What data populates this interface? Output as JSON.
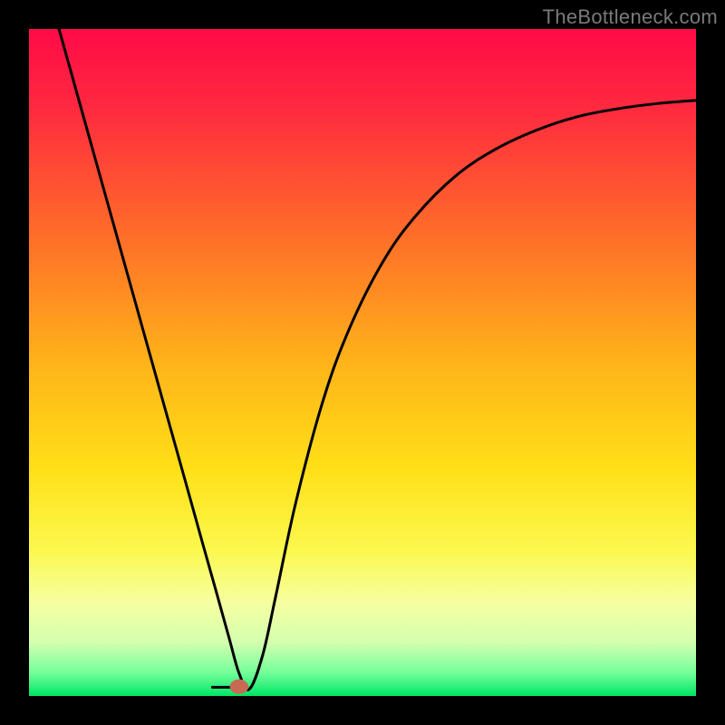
{
  "watermark": "TheBottleneck.com",
  "chart_data": {
    "type": "line",
    "title": "",
    "xlabel": "",
    "ylabel": "",
    "xlim": [
      0,
      100
    ],
    "ylim": [
      0,
      100
    ],
    "gradient_stops": [
      {
        "offset": 0.0,
        "color": "#ff0b47"
      },
      {
        "offset": 0.12,
        "color": "#ff2a3f"
      },
      {
        "offset": 0.3,
        "color": "#ff6a2a"
      },
      {
        "offset": 0.5,
        "color": "#ffb319"
      },
      {
        "offset": 0.66,
        "color": "#ffe018"
      },
      {
        "offset": 0.78,
        "color": "#fbf84d"
      },
      {
        "offset": 0.86,
        "color": "#f6ffa0"
      },
      {
        "offset": 0.92,
        "color": "#d4ffb0"
      },
      {
        "offset": 0.965,
        "color": "#74ff9a"
      },
      {
        "offset": 1.0,
        "color": "#00e564"
      }
    ],
    "series": [
      {
        "name": "bottleneck-curve",
        "x": [
          4.5,
          10,
          15,
          20,
          24,
          26,
          28,
          30,
          31.5,
          33,
          35,
          37,
          40,
          44,
          48,
          53,
          58,
          64,
          70,
          76,
          82,
          88,
          94,
          100
        ],
        "y": [
          100,
          80.3,
          62.4,
          44.5,
          30.2,
          23.0,
          15.9,
          8.7,
          3.4,
          1.0,
          6.0,
          15.0,
          29.0,
          44.0,
          55.0,
          65.0,
          72.0,
          78.0,
          82.0,
          84.8,
          86.8,
          88.0,
          88.8,
          89.3
        ]
      }
    ],
    "marker": {
      "x": 31.5,
      "y": 1.4,
      "rx": 1.4,
      "ry": 1.1,
      "color": "#c86a53"
    },
    "flat_segment": {
      "x0": 27.5,
      "x1": 31.5,
      "y": 1.3
    }
  }
}
